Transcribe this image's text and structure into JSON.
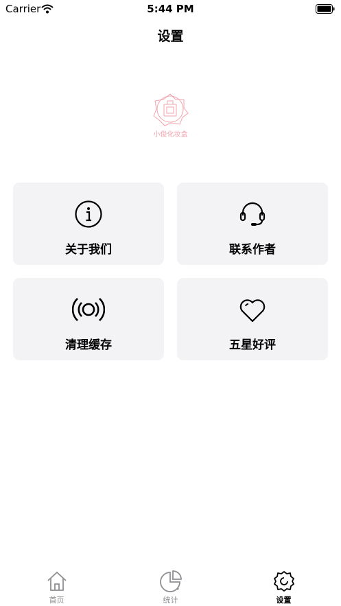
{
  "status_bar": {
    "carrier": "Carrier",
    "time": "5:44 PM"
  },
  "nav": {
    "title": "设置"
  },
  "logo": {
    "text": "小俊化妆盒",
    "color": "#f2a3ad"
  },
  "cards": [
    {
      "label": "关于我们",
      "icon": "info-icon"
    },
    {
      "label": "联系作者",
      "icon": "headset-icon"
    },
    {
      "label": "清理缓存",
      "icon": "broadcast-icon"
    },
    {
      "label": "五星好评",
      "icon": "heart-icon"
    }
  ],
  "tabs": [
    {
      "label": "首页",
      "icon": "home-icon"
    },
    {
      "label": "统计",
      "icon": "pie-chart-icon"
    },
    {
      "label": "设置",
      "icon": "gear-icon",
      "active": true
    }
  ]
}
